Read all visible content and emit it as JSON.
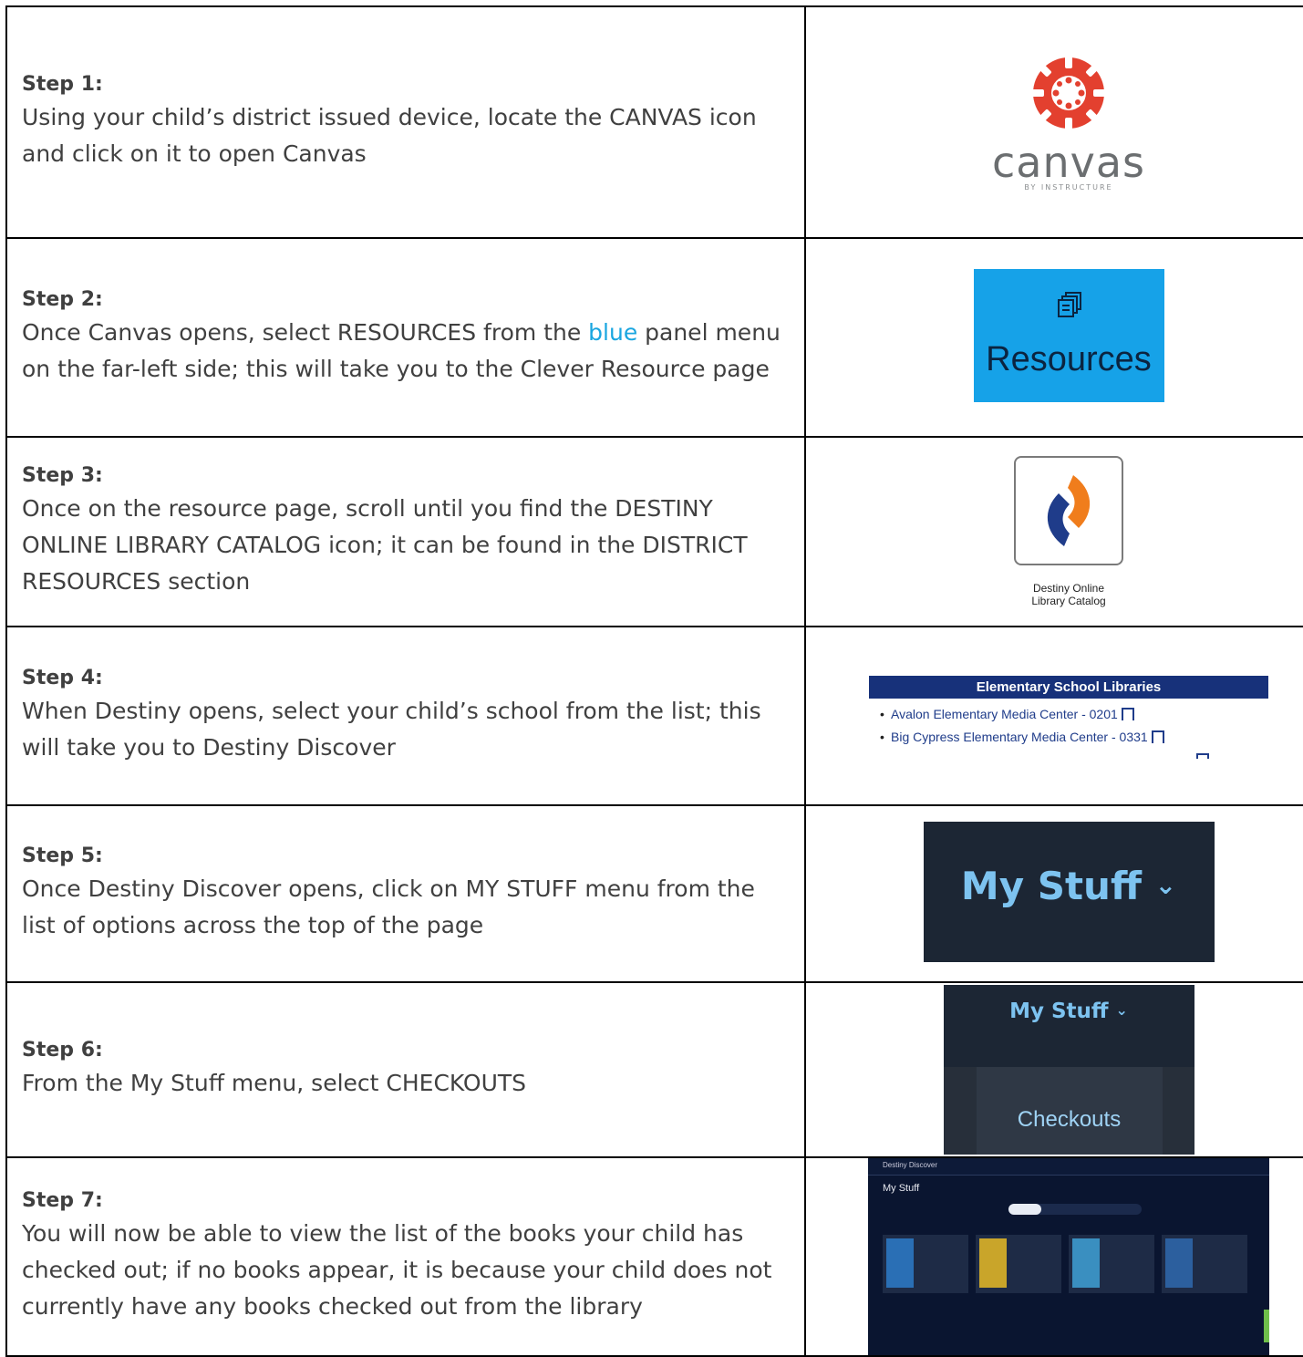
{
  "steps": [
    {
      "title": "Step 1:",
      "desc_lines": "Using your child’s district issued device, locate the CANVAS icon and click on it to open Canvas"
    },
    {
      "title": "Step 2:",
      "desc_pre": "Once Canvas opens, select RESOURCES from the ",
      "desc_blue": "blue",
      "desc_post": " panel menu on the far-left side; this will take you to the Clever Resource page"
    },
    {
      "title": "Step 3:",
      "desc": "Once on the resource page, scroll until you find the DESTINY ONLINE LIBRARY CATALOG icon; it can be found in the DISTRICT RESOURCES section"
    },
    {
      "title": "Step 4:",
      "desc": "When Destiny opens, select your child’s school from the list; this will take you to Destiny Discover"
    },
    {
      "title": "Step 5:",
      "desc": "Once Destiny Discover opens, click on MY STUFF menu from the list of options across the top of the page"
    },
    {
      "title": "Step 6:",
      "desc": "From the My Stuff menu, select CHECKOUTS"
    },
    {
      "title": "Step 7:",
      "desc": "You will now be able to view the list of the books your child has checked out; if no books appear, it is because your child does not currently have any books checked out from the library"
    }
  ],
  "images": {
    "canvas": {
      "word": "canvas",
      "sub": "BY INSTRUCTURE",
      "color": "#e3402f"
    },
    "resources": {
      "label": "Resources",
      "bg": "#16a2e8"
    },
    "destiny": {
      "label_line1": "Destiny Online",
      "label_line2": "Library Catalog"
    },
    "libraries": {
      "heading": "Elementary School Libraries",
      "items": [
        "Avalon Elementary Media Center - 0201",
        "Big Cypress Elementary Media Center - 0331"
      ]
    },
    "mystuff": {
      "label": "My Stuff",
      "chevron": "⌄"
    },
    "checkouts": {
      "menu": "My Stuff",
      "chevron": "⌄",
      "item": "Checkouts"
    },
    "discover": {
      "brand": "Destiny Discover",
      "title": "My Stuff"
    }
  }
}
